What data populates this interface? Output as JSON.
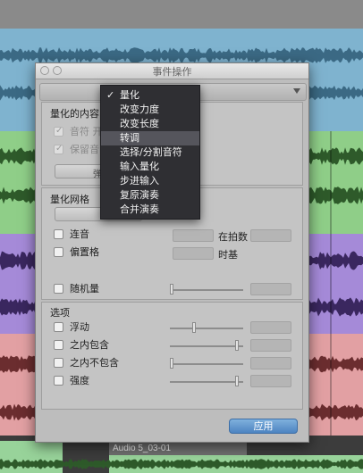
{
  "dialog": {
    "title": "事件操作",
    "quantize_content_label": "量化的内容",
    "note_start": "音符 开",
    "keep_note": "保留音",
    "button_truncated": "弹",
    "quantize_grid_label": "量化网格",
    "legato": "连音",
    "in_beats": "在拍数",
    "offset_grid": "偏置格",
    "timebase": "时基",
    "random": "随机量",
    "options_label": "选项",
    "swing": "浮动",
    "include_within": "之内包含",
    "exclude_within": "之内不包含",
    "strength": "强度",
    "apply_button": "应用"
  },
  "menu": {
    "items": [
      {
        "label": "量化",
        "checked": true
      },
      {
        "label": "改变力度"
      },
      {
        "label": "改变长度"
      },
      {
        "label": "转调",
        "highlighted": true
      },
      {
        "label": "选择/分割音符"
      },
      {
        "label": "输入量化"
      },
      {
        "label": "步进输入"
      },
      {
        "label": "复原演奏"
      },
      {
        "label": "合并演奏"
      }
    ],
    "check_mark": "✓"
  },
  "tracks": {
    "clip_label": "Audio 5_03-01",
    "colors": {
      "blue": "#7fb3cf",
      "green": "#8fce88",
      "purple": "#a58ad8",
      "red": "#e2a0a3",
      "light_green": "#98d39a",
      "wave_dark_blue": "#2b5670",
      "wave_dark_green": "#2e5a2a",
      "wave_dark_purple": "#3a275f",
      "wave_dark_red": "#6b2d2f"
    }
  }
}
